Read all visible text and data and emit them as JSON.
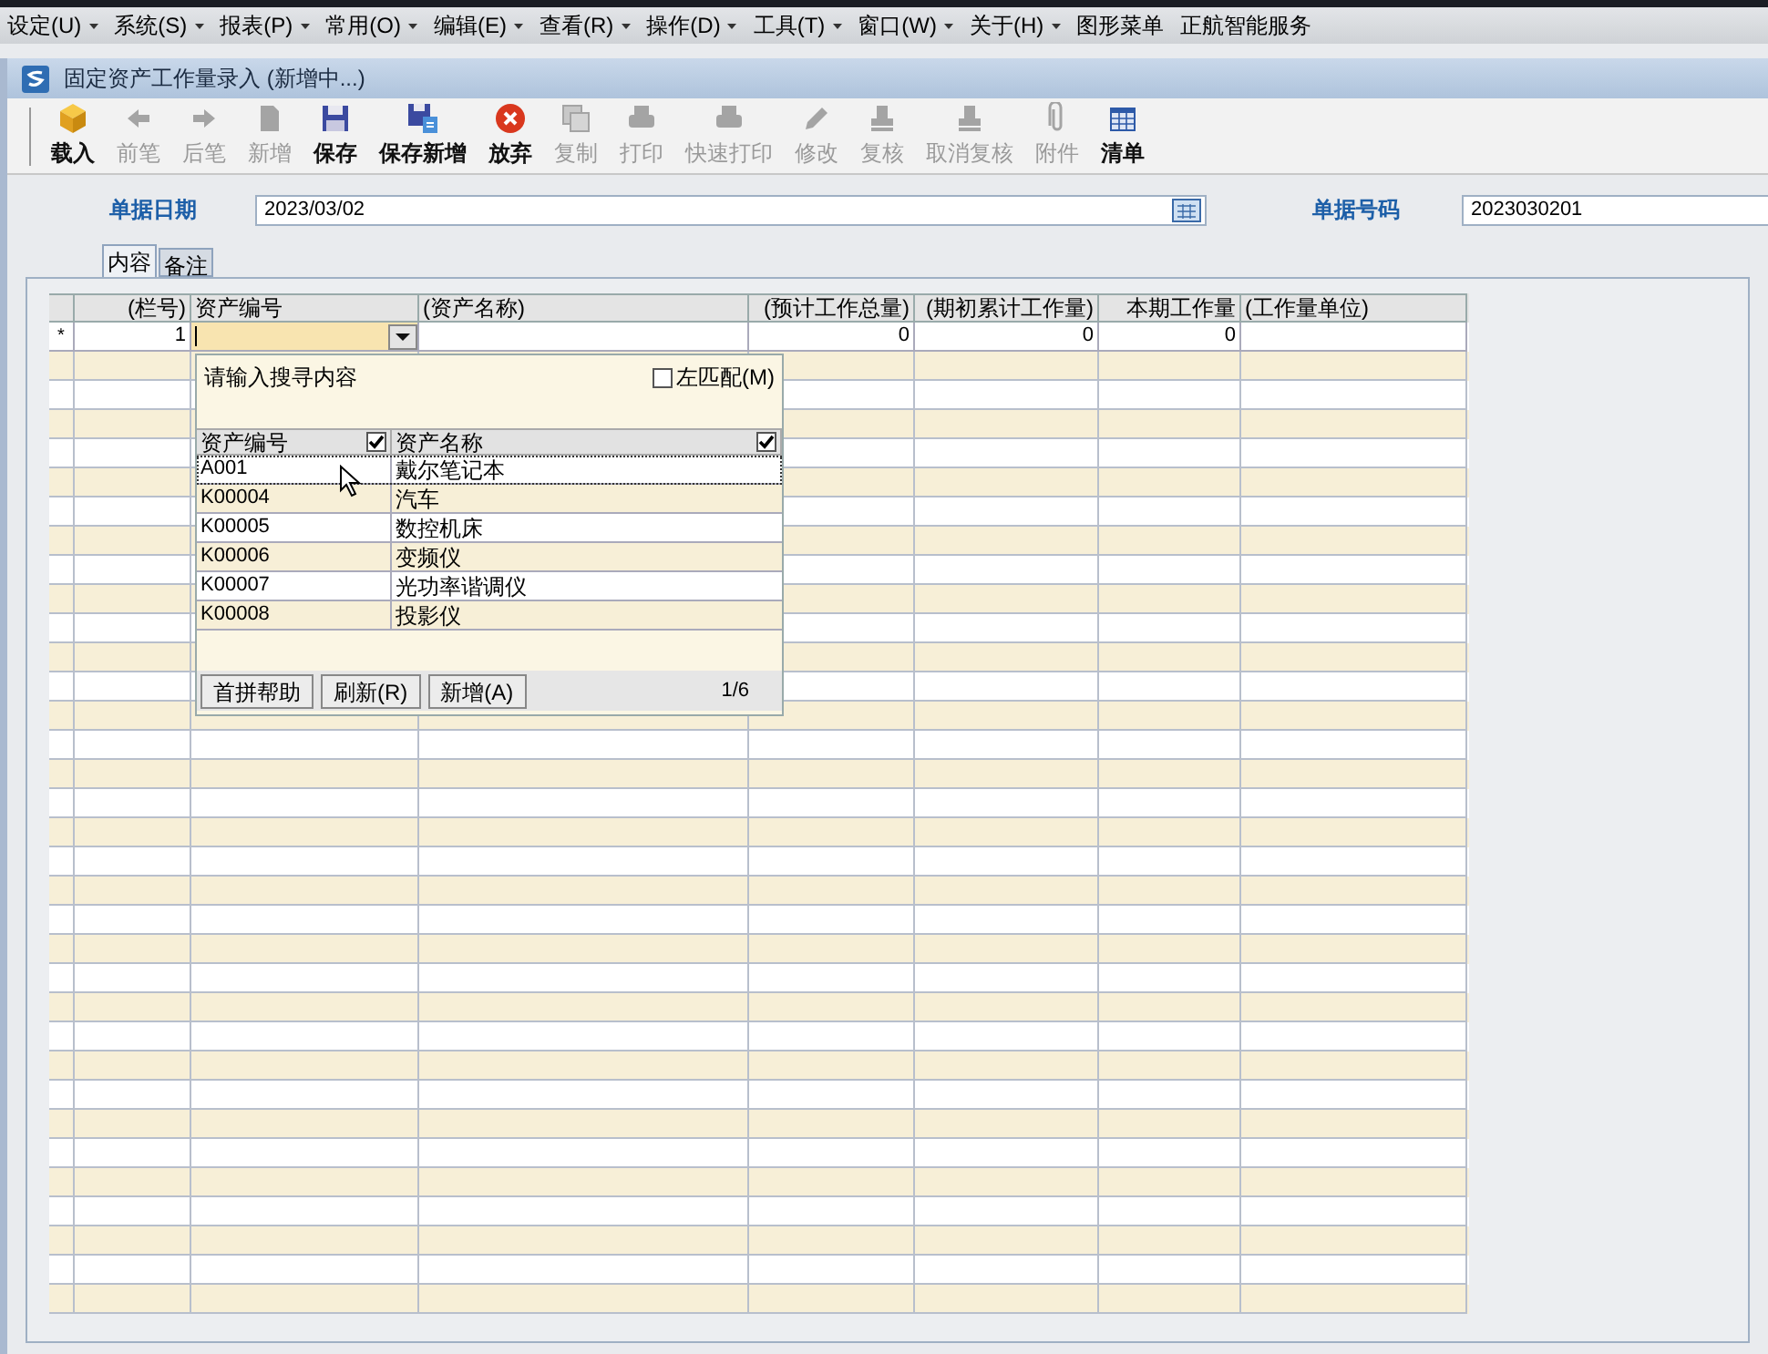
{
  "menu": [
    {
      "label": "设定(U)",
      "dropdown": true
    },
    {
      "label": "系统(S)",
      "dropdown": true
    },
    {
      "label": "报表(P)",
      "dropdown": true
    },
    {
      "label": "常用(O)",
      "dropdown": true
    },
    {
      "label": "编辑(E)",
      "dropdown": true
    },
    {
      "label": "查看(R)",
      "dropdown": true
    },
    {
      "label": "操作(D)",
      "dropdown": true
    },
    {
      "label": "工具(T)",
      "dropdown": true
    },
    {
      "label": "窗口(W)",
      "dropdown": true
    },
    {
      "label": "关于(H)",
      "dropdown": true
    },
    {
      "label": "图形菜单",
      "dropdown": false
    },
    {
      "label": "正航智能服务",
      "dropdown": false
    }
  ],
  "window": {
    "title": "固定资产工作量录入 (新增中...)"
  },
  "toolbar": [
    {
      "label": "载入",
      "kind": "box",
      "disabled": false
    },
    {
      "label": "前笔",
      "kind": "left",
      "disabled": true
    },
    {
      "label": "后笔",
      "kind": "right",
      "disabled": true
    },
    {
      "label": "新增",
      "kind": "page",
      "disabled": true
    },
    {
      "label": "保存",
      "kind": "disk",
      "disabled": false
    },
    {
      "label": "保存新增",
      "kind": "disknew",
      "disabled": false
    },
    {
      "label": "放弃",
      "kind": "cancel",
      "disabled": false
    },
    {
      "label": "复制",
      "kind": "copy",
      "disabled": true
    },
    {
      "label": "打印",
      "kind": "print",
      "disabled": true
    },
    {
      "label": "快速打印",
      "kind": "print",
      "disabled": true
    },
    {
      "label": "修改",
      "kind": "edit",
      "disabled": true
    },
    {
      "label": "复核",
      "kind": "stamp",
      "disabled": true
    },
    {
      "label": "取消复核",
      "kind": "stamp",
      "disabled": true
    },
    {
      "label": "附件",
      "kind": "clip",
      "disabled": true
    },
    {
      "label": "清单",
      "kind": "list",
      "disabled": false
    }
  ],
  "form": {
    "date_label": "单据日期",
    "date_value": "2023/03/02",
    "number_label": "单据号码",
    "number_value": "2023030201"
  },
  "tabs": [
    {
      "label": "内容",
      "selected": true
    },
    {
      "label": "备注",
      "selected": false
    }
  ],
  "table": {
    "columns": [
      "(栏号)",
      "资产编号",
      "(资产名称)",
      "(预计工作总量)",
      "(期初累计工作量)",
      "本期工作量",
      "(工作量单位)"
    ],
    "rows": [
      {
        "marker": "*",
        "cells": [
          "1",
          "",
          "",
          "0",
          "0",
          "0",
          ""
        ]
      }
    ]
  },
  "lookup": {
    "placeholder": "请输入搜寻内容",
    "left_match": {
      "label": "左匹配(M)",
      "checked": false
    },
    "columns": [
      {
        "label": "资产编号",
        "checked": true
      },
      {
        "label": "资产名称",
        "checked": true
      }
    ],
    "rows": [
      {
        "code": "A001",
        "name": "戴尔笔记本",
        "selected": true
      },
      {
        "code": "K00004",
        "name": "汽车",
        "selected": false
      },
      {
        "code": "K00005",
        "name": "数控机床",
        "selected": false
      },
      {
        "code": "K00006",
        "name": "变频仪",
        "selected": false
      },
      {
        "code": "K00007",
        "name": "光功率谐调仪",
        "selected": false
      },
      {
        "code": "K00008",
        "name": "投影仪",
        "selected": false
      }
    ],
    "buttons": [
      "首拼帮助",
      "刷新(R)",
      "新增(A)"
    ],
    "page": "1/6"
  }
}
